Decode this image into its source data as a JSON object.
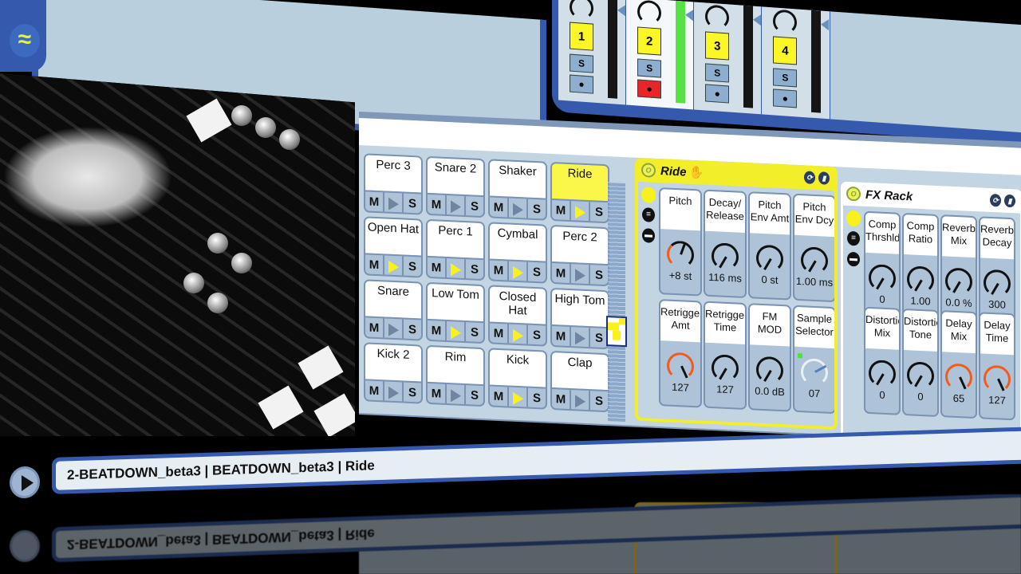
{
  "app": {
    "title_path": "2-BEATDOWN_beta3 | BEATDOWN_beta3 | Ride"
  },
  "browser": {
    "wave_icon": "≈"
  },
  "mixer": {
    "tracks": [
      {
        "number": "1",
        "solo": "S",
        "arm": "●",
        "selected": false,
        "armed": false,
        "meter_active": false
      },
      {
        "number": "2",
        "solo": "S",
        "arm": "●",
        "selected": true,
        "armed": true,
        "meter_active": true
      },
      {
        "number": "3",
        "solo": "S",
        "arm": "●",
        "selected": false,
        "armed": false,
        "meter_active": false
      },
      {
        "number": "4",
        "solo": "S",
        "arm": "●",
        "selected": false,
        "armed": false,
        "meter_active": false
      }
    ]
  },
  "drum_rack": {
    "mute_label": "M",
    "solo_label": "S",
    "pads": [
      [
        {
          "name": "Perc 3",
          "playing": false,
          "selected": false
        },
        {
          "name": "Snare 2",
          "playing": false,
          "selected": false
        },
        {
          "name": "Shaker",
          "playing": false,
          "selected": false
        },
        {
          "name": "Ride",
          "playing": true,
          "selected": true
        }
      ],
      [
        {
          "name": "Open Hat",
          "playing": true,
          "selected": false
        },
        {
          "name": "Perc 1",
          "playing": true,
          "selected": false
        },
        {
          "name": "Cymbal",
          "playing": true,
          "selected": false
        },
        {
          "name": "Perc 2",
          "playing": false,
          "selected": false
        }
      ],
      [
        {
          "name": "Snare",
          "playing": false,
          "selected": false
        },
        {
          "name": "Low Tom",
          "playing": true,
          "selected": false
        },
        {
          "name": "Closed Hat",
          "playing": true,
          "selected": false
        },
        {
          "name": "High Tom",
          "playing": false,
          "selected": false
        }
      ],
      [
        {
          "name": "Kick 2",
          "playing": false,
          "selected": false
        },
        {
          "name": "Rim",
          "playing": false,
          "selected": false
        },
        {
          "name": "Kick",
          "playing": true,
          "selected": false
        },
        {
          "name": "Clap",
          "playing": false,
          "selected": false
        }
      ]
    ]
  },
  "ride_device": {
    "title": "Ride",
    "hand_icon": "✋",
    "macros": [
      {
        "label": "Pitch",
        "value": "+8 st",
        "style": "hot-low"
      },
      {
        "label": "Decay/ Release",
        "value": "116 ms",
        "style": "normal"
      },
      {
        "label": "Pitch Env Amt",
        "value": "0 st",
        "style": "normal"
      },
      {
        "label": "Pitch Env Dcy",
        "value": "1.00 ms",
        "style": "normal"
      },
      {
        "label": "Retrigger Amt",
        "value": "127",
        "style": "hot"
      },
      {
        "label": "Retrigger Time",
        "value": "127",
        "style": "normal"
      },
      {
        "label": "FM MOD",
        "value": "0.0 dB",
        "style": "normal"
      },
      {
        "label": "Sample Selector",
        "value": "07",
        "style": "dim"
      }
    ]
  },
  "fx_rack": {
    "title": "FX Rack",
    "macros": [
      {
        "label": "Comp Thrshld",
        "value": "0",
        "style": "normal"
      },
      {
        "label": "Comp Ratio",
        "value": "1.00",
        "style": "normal"
      },
      {
        "label": "Reverb Mix",
        "value": "0.0 %",
        "style": "normal"
      },
      {
        "label": "Reverb Decay",
        "value": "300 ms",
        "style": "normal"
      },
      {
        "label": "Distortion Mix",
        "value": "0",
        "style": "normal"
      },
      {
        "label": "Distortion Tone",
        "value": "0",
        "style": "normal"
      },
      {
        "label": "Delay Mix",
        "value": "65",
        "style": "hot"
      },
      {
        "label": "Delay Time",
        "value": "127",
        "style": "hot"
      }
    ]
  },
  "colors": {
    "accent_blue": "#3559ad",
    "panel_bg": "#c3d4e2",
    "highlight_yellow": "#f3ee2a",
    "knob_hot": "#f35a1d",
    "meter_green": "#58e046",
    "arm_red": "#e8262a"
  }
}
